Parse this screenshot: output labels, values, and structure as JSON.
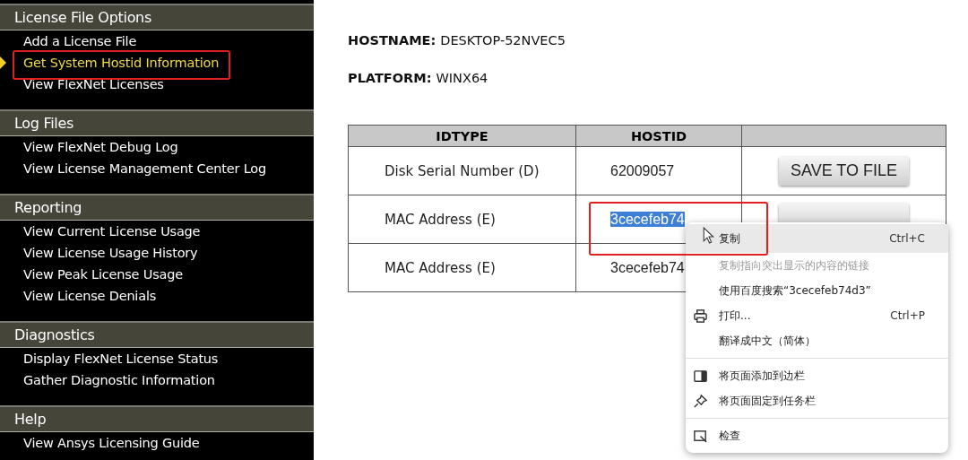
{
  "sidebar": {
    "sections": [
      {
        "title": "License File Options",
        "items": [
          {
            "label": "Add a License File",
            "selected": false
          },
          {
            "label": "Get System Hostid Information",
            "selected": true
          },
          {
            "label": "View FlexNet Licenses",
            "selected": false
          }
        ]
      },
      {
        "title": "Log Files",
        "items": [
          {
            "label": "View FlexNet Debug Log",
            "selected": false
          },
          {
            "label": "View License Management Center Log",
            "selected": false
          }
        ]
      },
      {
        "title": "Reporting",
        "items": [
          {
            "label": "View Current License Usage",
            "selected": false
          },
          {
            "label": "View License Usage History",
            "selected": false
          },
          {
            "label": "View Peak License Usage",
            "selected": false
          },
          {
            "label": "View License Denials",
            "selected": false
          }
        ]
      },
      {
        "title": "Diagnostics",
        "items": [
          {
            "label": "Display FlexNet License Status",
            "selected": false
          },
          {
            "label": "Gather Diagnostic Information",
            "selected": false
          }
        ]
      },
      {
        "title": "Help",
        "items": [
          {
            "label": "View Ansys Licensing Guide",
            "selected": false
          }
        ]
      }
    ]
  },
  "info": [
    {
      "label": "HOSTNAME:",
      "value": "DESKTOP-52NVEC5"
    },
    {
      "label": "PLATFORM:",
      "value": "WINX64"
    }
  ],
  "table": {
    "columns": [
      "IDTYPE",
      "HOSTID"
    ],
    "rows": [
      {
        "idtype": "Disk Serial Number (D)",
        "hostid": "62009057",
        "hostid_selected": false,
        "button": "SAVE TO FILE"
      },
      {
        "idtype": "MAC Address (E)",
        "hostid": "3cecefeb74",
        "hostid_selected": true,
        "button_partly_hidden": true
      },
      {
        "idtype": "MAC Address (E)",
        "hostid": "3cecefeb74",
        "hostid_selected": false
      }
    ]
  },
  "context_menu": {
    "items": [
      {
        "kind": "item",
        "label": "复制",
        "shortcut": "Ctrl+C",
        "hovered": true,
        "disabled": false
      },
      {
        "kind": "item",
        "label": "复制指向突出显示的内容的链接",
        "hovered": false,
        "disabled": true
      },
      {
        "kind": "item",
        "label": "使用百度搜索“3cecefeb74d3”",
        "hovered": false,
        "disabled": false
      },
      {
        "kind": "item",
        "label": "打印...",
        "shortcut": "Ctrl+P",
        "hovered": false,
        "disabled": false
      },
      {
        "kind": "item",
        "label": "翻译成中文（简体）",
        "hovered": false,
        "disabled": false
      },
      {
        "kind": "separator"
      },
      {
        "kind": "item",
        "label": "将页面添加到边栏",
        "hovered": false,
        "disabled": false
      },
      {
        "kind": "item",
        "label": "将页面固定到任务栏",
        "hovered": false,
        "disabled": false
      },
      {
        "kind": "separator"
      },
      {
        "kind": "item",
        "label": "检查",
        "hovered": false,
        "disabled": false
      }
    ]
  }
}
